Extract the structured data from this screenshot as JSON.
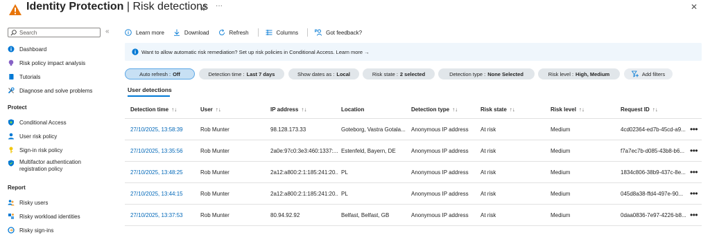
{
  "header": {
    "title_bold": "Identity Protection",
    "title_sep": " | ",
    "title_rest": "Risk detections",
    "more": "···",
    "close": "✕"
  },
  "sidebar": {
    "search_placeholder": "Search",
    "collapse": "«",
    "items_top": [
      {
        "label": "Dashboard",
        "icon": "info-circle-icon"
      },
      {
        "label": "Risk policy impact analysis",
        "icon": "bulb-icon"
      },
      {
        "label": "Tutorials",
        "icon": "book-icon"
      },
      {
        "label": "Diagnose and solve problems",
        "icon": "wrench-icon"
      }
    ],
    "section_protect": "Protect",
    "items_protect": [
      {
        "label": "Conditional Access",
        "icon": "shield-icon"
      },
      {
        "label": "User risk policy",
        "icon": "user-icon"
      },
      {
        "label": "Sign-in risk policy",
        "icon": "key-icon"
      },
      {
        "label": "Multifactor authentication",
        "label2": "registration policy",
        "icon": "shield-check-icon"
      }
    ],
    "section_report": "Report",
    "items_report": [
      {
        "label": "Risky users",
        "icon": "users-icon"
      },
      {
        "label": "Risky workload identities",
        "icon": "workload-icon"
      },
      {
        "label": "Risky sign-ins",
        "icon": "signin-icon"
      }
    ]
  },
  "toolbar": {
    "learn_more": "Learn more",
    "download": "Download",
    "refresh": "Refresh",
    "columns": "Columns",
    "feedback": "Got feedback?"
  },
  "banner": {
    "text": "Want to allow automatic risk remediation? Set up risk policies in Conditional Access. Learn more",
    "arrow": "→"
  },
  "filters": {
    "auto_refresh_label": "Auto refresh :",
    "auto_refresh_value": "Off",
    "detection_time_label": "Detection time :",
    "detection_time_value": "Last 7 days",
    "show_dates_label": "Show dates as :",
    "show_dates_value": "Local",
    "risk_state_label": "Risk state :",
    "risk_state_value": "2 selected",
    "detection_type_label": "Detection type :",
    "detection_type_value": "None Selected",
    "risk_level_label": "Risk level :",
    "risk_level_value": "High, Medium",
    "add_filters": "Add filters"
  },
  "tab": {
    "label": "User detections"
  },
  "table": {
    "columns": [
      "Detection time",
      "User",
      "IP address",
      "Location",
      "Detection type",
      "Risk state",
      "Risk level",
      "Request ID"
    ],
    "sort_glyph_first": "↑↓",
    "sort_glyph": "↑↓",
    "row_more": "•••",
    "rows": [
      [
        "27/10/2025, 13:58:39",
        "Rob Munter",
        "98.128.173.33",
        "Goteborg, Vastra Gotala...",
        "Anonymous IP address",
        "At risk",
        "Medium",
        "4cd02364-ed7b-45cd-a9..."
      ],
      [
        "27/10/2025, 13:35:56",
        "Rob Munter",
        "2a0e:97c0:3e3:460:1337:...",
        "Estenfeld, Bayern, DE",
        "Anonymous IP address",
        "At risk",
        "Medium",
        "f7a7ec7b-d085-43b8-b6..."
      ],
      [
        "27/10/2025, 13:48:25",
        "Rob Munter",
        "2a12:a800:2:1:185:241:20...",
        "PL",
        "Anonymous IP address",
        "At risk",
        "Medium",
        "1834c806-38b9-437c-8e..."
      ],
      [
        "27/10/2025, 13:44:15",
        "Rob Munter",
        "2a12:a800:2:1:185:241:20...",
        "PL",
        "Anonymous IP address",
        "At risk",
        "Medium",
        "045d8a38-ffd4-497e-90..."
      ],
      [
        "27/10/2025, 13:37:53",
        "Rob Munter",
        "80.94.92.92",
        "Belfast, Belfast, GB",
        "Anonymous IP address",
        "At risk",
        "Medium",
        "0daa0836-7e97-4226-b8..."
      ]
    ]
  },
  "colors": {
    "accent": "#0078d4",
    "link": "#0067b8",
    "warning": "#e8750a",
    "banner_bg": "#eff6fc"
  }
}
